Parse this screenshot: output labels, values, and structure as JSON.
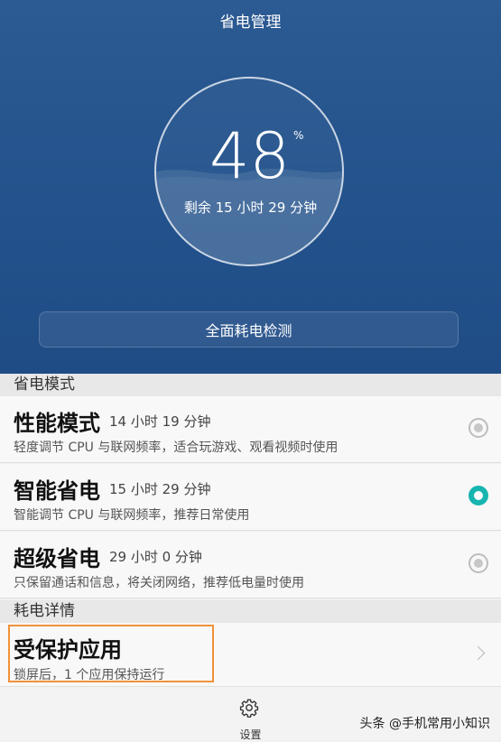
{
  "header": {
    "title": "省电管理",
    "battery_percent": "48",
    "percent_sign": "%",
    "remaining": "剩余 15 小时 29 分钟",
    "detect_button": "全面耗电检测"
  },
  "power_modes": {
    "section_title": "省电模式",
    "items": [
      {
        "name": "性能模式",
        "time": "14 小时 19 分钟",
        "desc": "轻度调节 CPU 与联网频率，适合玩游戏、观看视频时使用",
        "selected": false
      },
      {
        "name": "智能省电",
        "time": "15 小时 29 分钟",
        "desc": "智能调节 CPU 与联网频率，推荐日常使用",
        "selected": true
      },
      {
        "name": "超级省电",
        "time": "29 小时 0 分钟",
        "desc": "只保留通话和信息，将关闭网络，推荐低电量时使用",
        "selected": false
      }
    ]
  },
  "consumption": {
    "section_title": "耗电详情",
    "protected_apps_title": "受保护应用",
    "protected_apps_desc": "锁屏后，1 个应用保持运行"
  },
  "bottom_bar": {
    "settings_label": "设置",
    "settings_icon": "gear-icon",
    "watermark": "头条 @手机常用小知识"
  },
  "colors": {
    "header_blue": "#23528c",
    "accent_teal": "#18b5b0",
    "highlight_orange": "#f0923a"
  }
}
